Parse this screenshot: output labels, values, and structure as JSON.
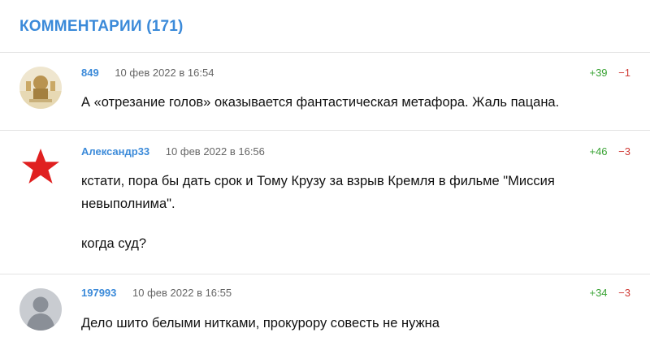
{
  "header": {
    "title": "КОММЕНТАРИИ (171)"
  },
  "comments": [
    {
      "author": "849",
      "date": "10 фев 2022 в 16:54",
      "up": "+39",
      "down": "−1",
      "text": "А «отрезание голов» оказывается фантастическая метафора. Жаль пацана."
    },
    {
      "author": "Александр33",
      "date": "10 фев 2022 в 16:56",
      "up": "+46",
      "down": "−3",
      "text_line1": "кстати, пора бы дать срок и Тому Крузу за взрыв Кремля в фильме \"Миссия",
      "text_line2": "невыполнима\".",
      "text_line3": "когда суд?"
    },
    {
      "author": "197993",
      "date": "10 фев 2022 в 16:55",
      "up": "+34",
      "down": "−3",
      "text": "Дело шито белыми нитками, прокурору совесть не нужна"
    }
  ],
  "colors": {
    "accent": "#3b8ad9",
    "upvote": "#3aa335",
    "downvote": "#d03b36",
    "star": "#e02020"
  },
  "icons": [
    "user-photo-avatar",
    "red-star-avatar",
    "default-user-avatar"
  ]
}
